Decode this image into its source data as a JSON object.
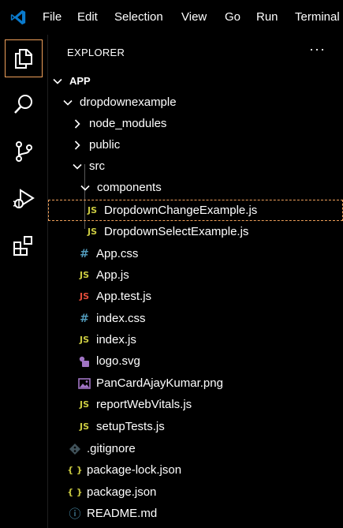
{
  "menu": [
    "File",
    "Edit",
    "Selection",
    "View",
    "Go",
    "Run",
    "Terminal"
  ],
  "explorer": {
    "title": "EXPLORER",
    "more": "···"
  },
  "tree": {
    "root": "APP",
    "project": "dropdownexample",
    "node_modules": "node_modules",
    "public": "public",
    "src": "src",
    "components": "components",
    "dropdown_change": "DropdownChangeExample.js",
    "dropdown_select": "DropdownSelectExample.js",
    "app_css": "App.css",
    "app_js": "App.js",
    "app_test": "App.test.js",
    "index_css": "index.css",
    "index_js": "index.js",
    "logo": "logo.svg",
    "pancard": "PanCardAjayKumar.png",
    "report": "reportWebVitals.js",
    "setup": "setupTests.js",
    "gitignore": ".gitignore",
    "package_lock": "package-lock.json",
    "package": "package.json",
    "readme": "README.md"
  },
  "icon_glyphs": {
    "js": "JS",
    "css": "#",
    "json": "{ }",
    "info": "ⓘ"
  },
  "colors": {
    "accent": "#f0a05a",
    "js": "#cbcb41",
    "test": "#e44d3a",
    "css": "#519aba",
    "vscode": "#0a7acc",
    "svg": "#a074c4"
  }
}
